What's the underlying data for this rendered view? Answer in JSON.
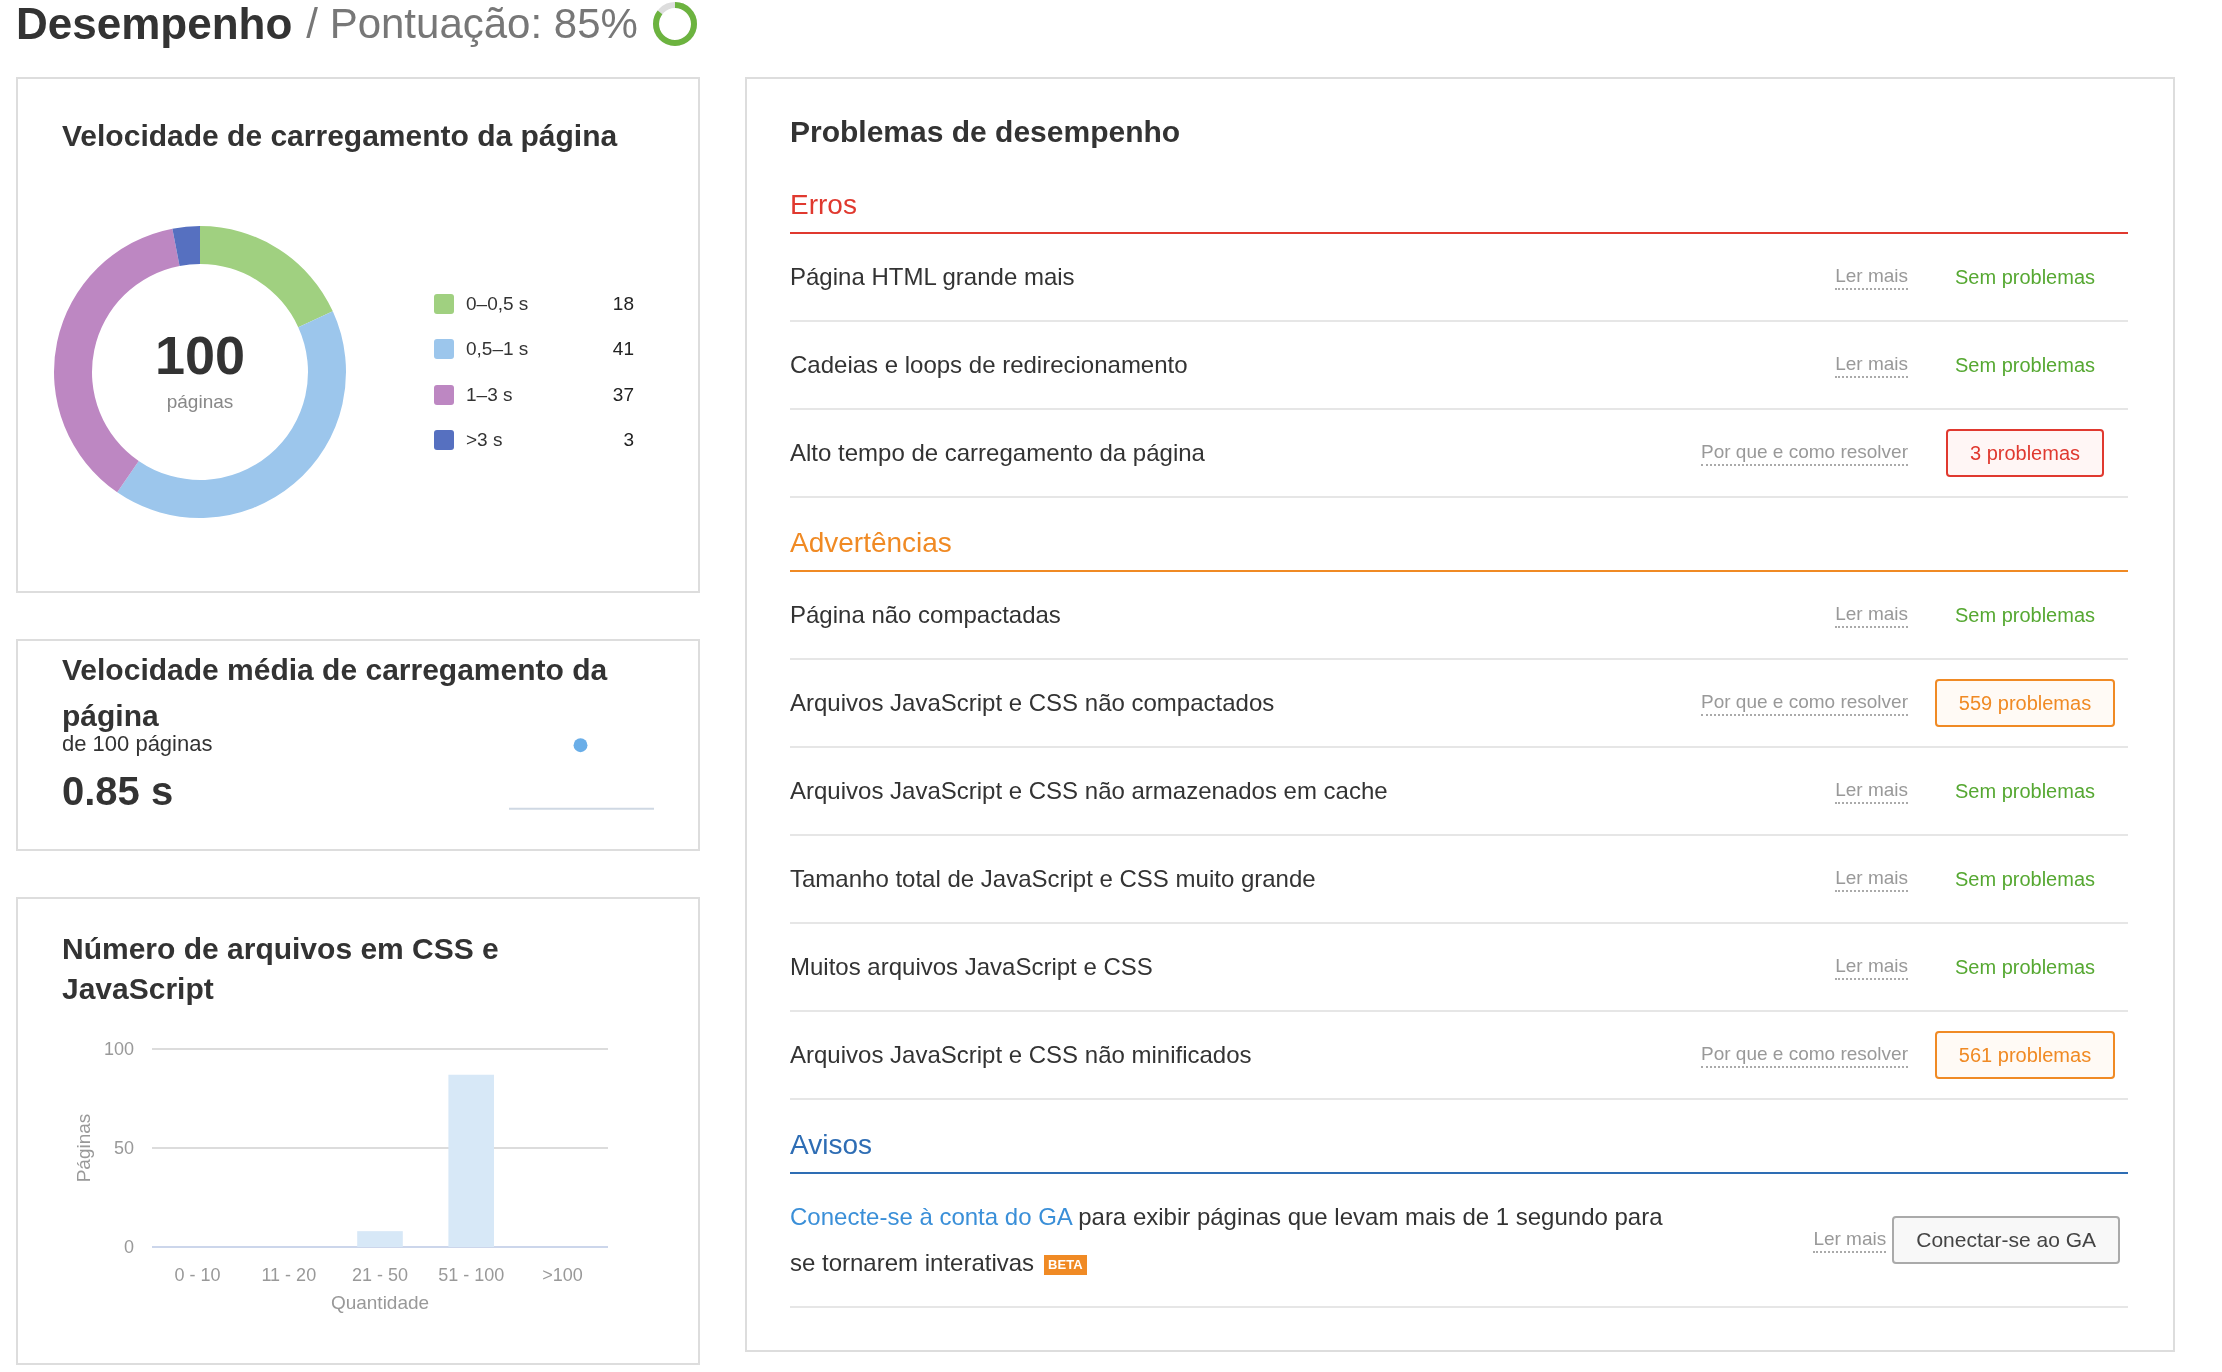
{
  "header": {
    "title": "Desempenho",
    "score_text": "/ Pontuação: 85%",
    "score": {
      "level": 0.85
    }
  },
  "load_speed": {
    "title": "Velocidade de carregamento da página",
    "total": "100",
    "total_label": "páginas",
    "legend": [
      {
        "label": "0–0,5 s",
        "value": "18",
        "color": "#a0d080"
      },
      {
        "label": "0,5–1 s",
        "value": "41",
        "color": "#9cc6ec"
      },
      {
        "label": "1–3 s",
        "value": "37",
        "color": "#bd87c2"
      },
      {
        "label": ">3 s",
        "value": "3",
        "color": "#5670c0"
      }
    ],
    "chart_data": {
      "type": "donut",
      "values": [
        18,
        41,
        37,
        3
      ]
    }
  },
  "avg_speed": {
    "title": "Velocidade média de carregamento da página",
    "subtitle": "de 100 páginas",
    "value": "0.85 s"
  },
  "files": {
    "title": "Número de arquivos em CSS e JavaScript",
    "chart_data": {
      "type": "bar",
      "xlabel": "Quantidade",
      "ylabel": "Páginas",
      "categories": [
        "0 - 10",
        "11 - 20",
        "21 - 50",
        "51 - 100",
        ">100"
      ],
      "values": [
        0,
        0,
        8,
        87,
        0
      ],
      "ylim": [
        0,
        100
      ],
      "yticks": [
        0,
        50,
        100
      ]
    }
  },
  "problems": {
    "title": "Problemas de desempenho",
    "sections": [
      {
        "title": "Erros",
        "kind": "error",
        "rows": [
          {
            "kind": "issue",
            "label": "Página HTML grande mais",
            "help": "Ler mais",
            "status": "Sem problemas",
            "has_issues": false
          },
          {
            "kind": "issue",
            "label": "Cadeias e loops de redirecionamento",
            "help": "Ler mais",
            "status": "Sem problemas",
            "has_issues": false
          },
          {
            "kind": "issue",
            "label": "Alto tempo de carregamento da página",
            "help": "Por que e como resolver",
            "status": "3 problemas",
            "has_issues": true
          }
        ]
      },
      {
        "title": "Advertências",
        "kind": "warning",
        "rows": [
          {
            "kind": "issue",
            "label": "Página não compactadas",
            "help": "Ler mais",
            "status": "Sem problemas",
            "has_issues": false
          },
          {
            "kind": "issue",
            "label": "Arquivos JavaScript e CSS não compactados",
            "help": "Por que e como resolver",
            "status": "559 problemas",
            "has_issues": true
          },
          {
            "kind": "issue",
            "label": "Arquivos JavaScript e CSS não armazenados em cache",
            "help": "Ler mais",
            "status": "Sem problemas",
            "has_issues": false
          },
          {
            "kind": "issue",
            "label": "Tamanho total de JavaScript e CSS muito grande",
            "help": "Ler mais",
            "status": "Sem problemas",
            "has_issues": false
          },
          {
            "kind": "issue",
            "label": "Muitos arquivos JavaScript e CSS",
            "help": "Ler mais",
            "status": "Sem problemas",
            "has_issues": false
          },
          {
            "kind": "issue",
            "label": "Arquivos JavaScript e CSS não minificados",
            "help": "Por que e como resolver",
            "status": "561 problemas",
            "has_issues": true
          }
        ]
      },
      {
        "title": "Avisos",
        "kind": "notice",
        "rows": [
          {
            "kind": "connect",
            "link": "Conecte-se à conta do GA",
            "text": " para exibir páginas que levam mais de 1 segundo para se tornarem interativas",
            "badge": "BETA",
            "help": "Ler mais",
            "button": "Conectar-se ao GA"
          }
        ]
      }
    ]
  }
}
